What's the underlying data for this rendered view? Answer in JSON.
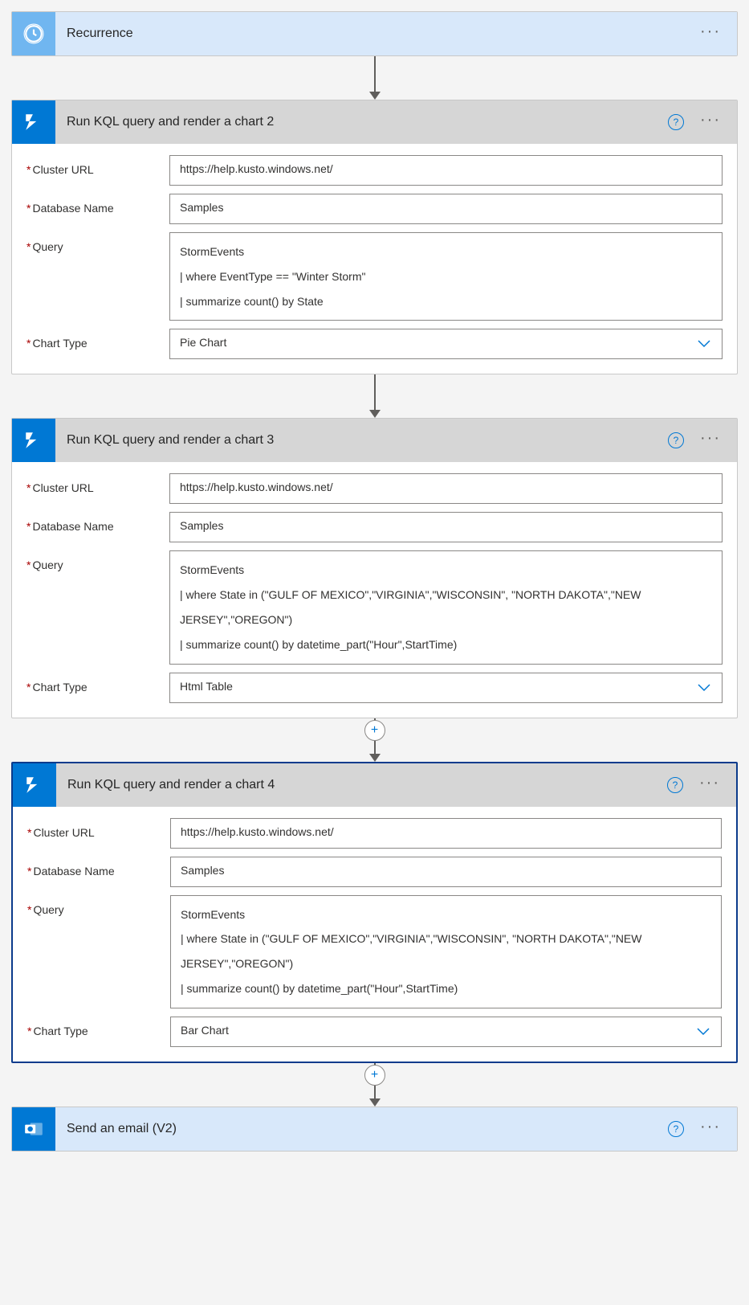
{
  "labels": {
    "cluster": "Cluster URL",
    "database": "Database Name",
    "query": "Query",
    "chartType": "Chart Type"
  },
  "steps": {
    "recurrence": {
      "title": "Recurrence"
    },
    "kql2": {
      "title": "Run KQL query and render a chart 2",
      "cluster": "https://help.kusto.windows.net/",
      "database": "Samples",
      "query": "StormEvents\n| where EventType == \"Winter Storm\"\n| summarize count() by State",
      "chartType": "Pie Chart"
    },
    "kql3": {
      "title": "Run KQL query and render a chart 3",
      "cluster": "https://help.kusto.windows.net/",
      "database": "Samples",
      "query": "StormEvents\n| where State in (\"GULF OF MEXICO\",\"VIRGINIA\",\"WISCONSIN\", \"NORTH DAKOTA\",\"NEW JERSEY\",\"OREGON\")\n| summarize count() by datetime_part(\"Hour\",StartTime)",
      "chartType": "Html Table"
    },
    "kql4": {
      "title": "Run KQL query and render a chart 4",
      "cluster": "https://help.kusto.windows.net/",
      "database": "Samples",
      "query": "StormEvents\n| where State in (\"GULF OF MEXICO\",\"VIRGINIA\",\"WISCONSIN\", \"NORTH DAKOTA\",\"NEW JERSEY\",\"OREGON\")\n| summarize count() by datetime_part(\"Hour\",StartTime)",
      "chartType": "Bar Chart"
    },
    "email": {
      "title": "Send an email (V2)"
    }
  }
}
